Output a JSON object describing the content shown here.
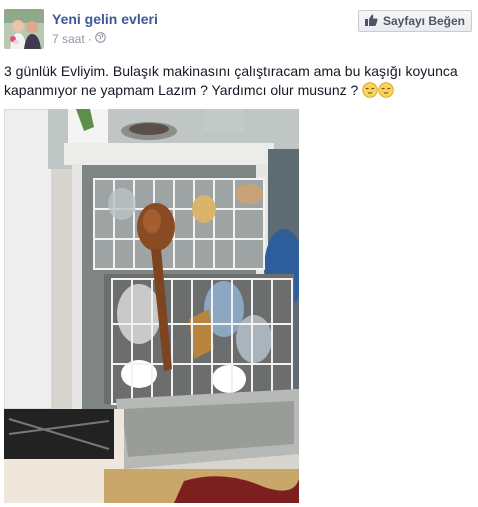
{
  "post": {
    "author": "Yeni gelin evleri",
    "time": "7 saat",
    "separator": "·",
    "privacy_icon": "globe-icon",
    "like_button_label": "Sayfayı Beğen",
    "like_icon": "thumbs-up-icon",
    "text": "3 günlük Evliyim. Bulaşık makinasını çalıştıracam ama bu kaşığı koyunca kapanmıyor ne yapmam Lazım ? Yardımcı olur musunz ?",
    "emojis": [
      "pensive-face-emoji",
      "pensive-face-emoji"
    ],
    "photo": "dishwasher-with-wooden-spoon-photo"
  },
  "colors": {
    "author_link": "#3b5998",
    "meta_text": "#9197a3",
    "body_text": "#141823"
  }
}
